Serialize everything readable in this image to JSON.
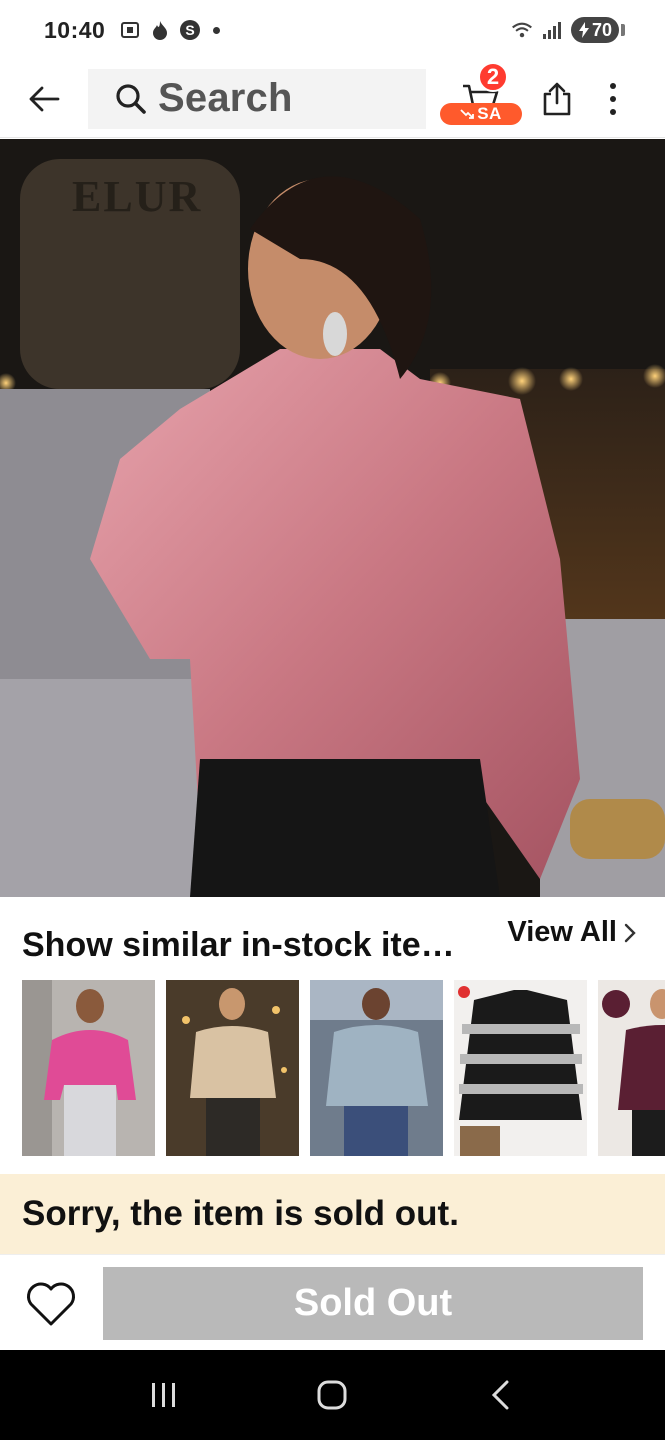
{
  "status_bar": {
    "time": "10:40",
    "battery": "70",
    "left_icons": [
      "screenshot-icon",
      "flame-icon",
      "s-badge-icon"
    ],
    "right_icons": [
      "wifi-icon",
      "signal-icon"
    ]
  },
  "header": {
    "search_placeholder": "Search",
    "cart_count": "2",
    "cart_tag": "SA",
    "back_icon": "back-arrow-icon",
    "share_icon": "share-icon",
    "more_icon": "more-vertical-icon"
  },
  "product": {
    "image_brand_text": "ELUR"
  },
  "similar": {
    "title": "Show similar in-stock ite…",
    "view_all_label": "View All",
    "items": [
      {
        "colors": [
          "#e04b96",
          "#8a8a8a"
        ]
      },
      {
        "colors": [
          "#d9c2a3",
          "#2d2a26"
        ]
      },
      {
        "colors": [
          "#9fb3c2",
          "#3b4f7a"
        ]
      },
      {
        "colors": [
          "#1a1a1a",
          "#b8b8b8"
        ]
      },
      {
        "colors": [
          "#5a1f33",
          "#c9b49a"
        ]
      }
    ]
  },
  "notice": {
    "text": "Sorry, the item is sold out."
  },
  "actions": {
    "wishlist_icon": "heart-outline-icon",
    "sold_out_label": "Sold Out"
  },
  "colors": {
    "accent_red": "#ff3b30",
    "accent_orange": "#ff5a2c",
    "banner_bg": "#fbefd6",
    "disabled_button": "#b9b9b9"
  }
}
